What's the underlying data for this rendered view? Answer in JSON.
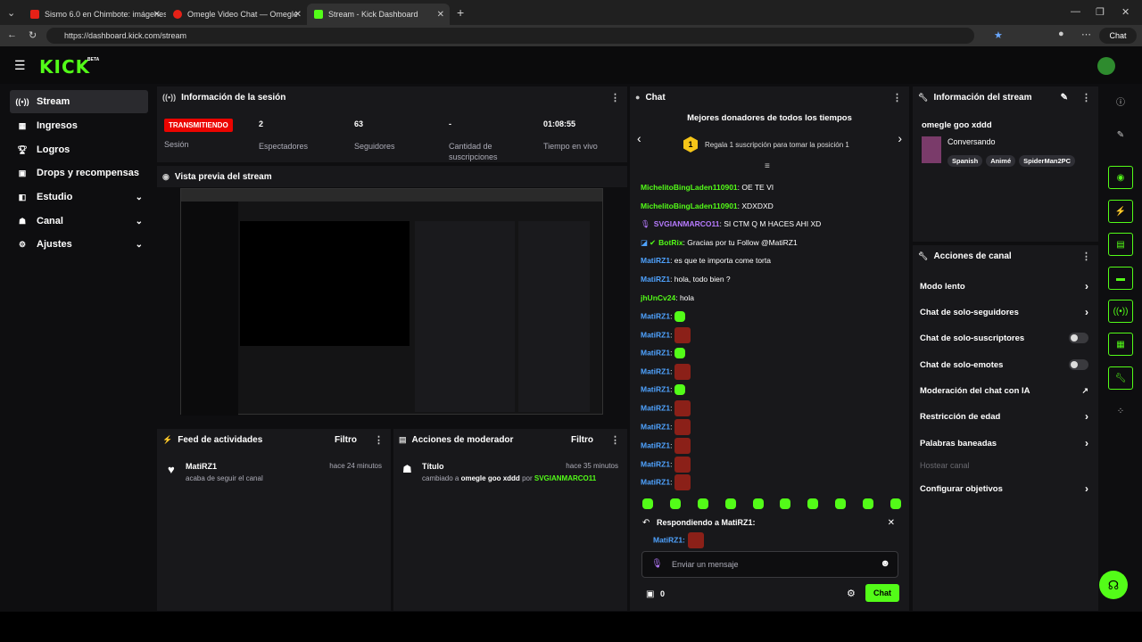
{
  "browser": {
    "tabs": [
      {
        "title": "Sismo 6.0 en Chimbote: imágenes"
      },
      {
        "title": "Omegle Video Chat — Omegle"
      },
      {
        "title": "Stream - Kick Dashboard"
      }
    ],
    "url": "https://dashboard.kick.com/stream",
    "chat_button": "Chat"
  },
  "app": {
    "logo": "KICK",
    "beta": "BETA"
  },
  "sidebar": {
    "items": [
      {
        "label": "Stream",
        "icon": "broadcast-icon"
      },
      {
        "label": "Ingresos",
        "icon": "revenue-icon"
      },
      {
        "label": "Logros",
        "icon": "trophy-icon"
      },
      {
        "label": "Drops y recompensas",
        "icon": "gift-icon"
      },
      {
        "label": "Estudio",
        "icon": "studio-icon"
      },
      {
        "label": "Canal",
        "icon": "users-icon"
      },
      {
        "label": "Ajustes",
        "icon": "gear-icon"
      }
    ]
  },
  "session": {
    "title": "Información de la sesión",
    "live_badge": "TRANSMITIENDO",
    "live_label": "Sesión",
    "stats": [
      {
        "value": "2",
        "label": "Espectadores"
      },
      {
        "value": "63",
        "label": "Seguidores"
      },
      {
        "value": "-",
        "label": "Cantidad de suscripciones"
      },
      {
        "value": "01:08:55",
        "label": "Tiempo en vivo"
      }
    ]
  },
  "preview": {
    "title": "Vista previa del stream"
  },
  "activity": {
    "title": "Feed de actividades",
    "filter": "Filtro",
    "item": {
      "user": "MatiRZ1",
      "time": "hace 24 minutos",
      "text": "acaba de seguir el canal"
    }
  },
  "moderator": {
    "title": "Acciones de moderador",
    "filter": "Filtro",
    "item": {
      "label": "Título",
      "time": "hace 35 minutos",
      "prefix": "cambiado a",
      "value": "omegle goo xddd",
      "by": "por",
      "user": "SVGIANMARCO11"
    }
  },
  "chat": {
    "title": "Chat",
    "donors_title": "Mejores donadores de todos los tiempos",
    "rank": "1",
    "donors_text": "Regala 1 suscripción para tomar la posición 1",
    "messages": [
      {
        "user": "MichelitoBingLaden110901",
        "text": ": OE TE VI",
        "color": "green"
      },
      {
        "user": "MichelitoBingLaden110901",
        "text": ": XDXDXD",
        "color": "green"
      },
      {
        "user": "SVGIANMARCO11",
        "text": ": SI CTM Q M HACES AHI XD",
        "color": "purple"
      },
      {
        "user": "BotRix",
        "text": ": Gracias por tu Follow @MatiRZ1",
        "color": "green"
      },
      {
        "user": "MatiRZ1",
        "text": ": es que te importa come torta",
        "color": "blue"
      },
      {
        "user": "MatiRZ1",
        "text": ": hola, todo bien ?",
        "color": "blue"
      },
      {
        "user": "jhUnCv24",
        "text": ": hola",
        "color": "green"
      }
    ],
    "emote_user": "MatiRZ1",
    "reply_label": "Respondiendo a MatiRZ1:",
    "reply_user": "MatiRZ1:",
    "input_placeholder": "Enviar un mensaje",
    "count": "0",
    "send": "Chat"
  },
  "stream_info": {
    "title": "Información del stream",
    "stream_title": "omegle goo xddd",
    "category": "Conversando",
    "tags": [
      "Spanish",
      "Animé",
      "SpiderMan2PC"
    ]
  },
  "channel_actions": {
    "title": "Acciones de canal",
    "items": [
      {
        "label": "Modo lento",
        "type": "chev"
      },
      {
        "label": "Chat de solo-seguidores",
        "type": "chev"
      },
      {
        "label": "Chat de solo-suscriptores",
        "type": "toggle"
      },
      {
        "label": "Chat de solo-emotes",
        "type": "toggle"
      },
      {
        "label": "Moderación del chat con IA",
        "type": "ext"
      },
      {
        "label": "Restricción de edad",
        "type": "chev"
      },
      {
        "label": "Palabras baneadas",
        "type": "chev"
      },
      {
        "label": "Hostear canal",
        "type": "disabled"
      },
      {
        "label": "Configurar objetivos",
        "type": "chev"
      }
    ]
  },
  "colors": {
    "accent": "#53fc18",
    "live": "#eb0400",
    "panel": "#18181b"
  }
}
